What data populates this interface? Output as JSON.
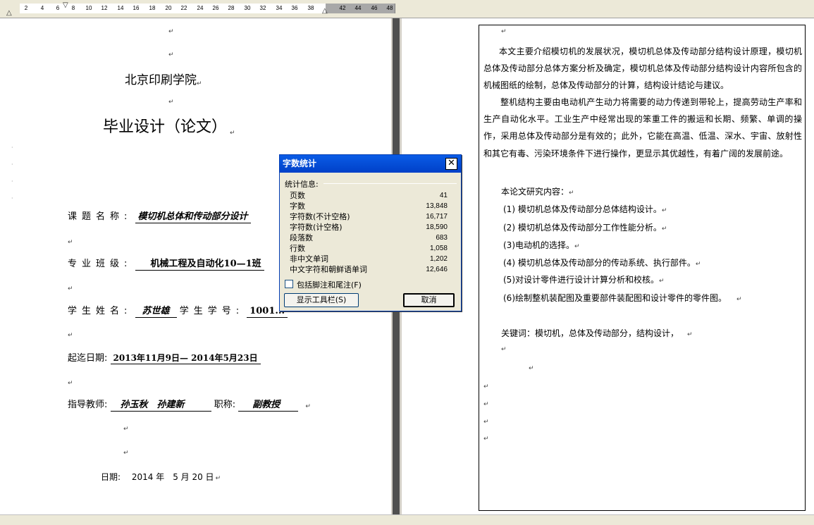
{
  "ruler": {
    "numbers": [
      "2",
      "4",
      "6",
      "8",
      "10",
      "12",
      "14",
      "16",
      "18",
      "20",
      "22",
      "24",
      "26",
      "28",
      "30",
      "32",
      "34",
      "36",
      "38",
      "42",
      "44",
      "46",
      "48"
    ]
  },
  "left_page": {
    "school_name": "北京印刷学院",
    "thesis_title": "毕业设计（论文）",
    "fields": {
      "topic_label": "课题名称:",
      "topic_value": "模切机总体和传动部分设计",
      "major_label": "专业班级:",
      "major_value": "机械工程及自动化10—1班",
      "student_label": "学生姓名:",
      "student_value": "苏世雄",
      "student_id_label": "学生学号:",
      "student_id_value": "1001...",
      "dates_label": "起迄日期:",
      "dates_value": "2013年11月9日— 2014年5月23日",
      "advisor_label": "指导教师:",
      "advisor_value": "孙玉秋　孙建新",
      "title_label": "职称:",
      "title_value": "副教授"
    },
    "date_line": "日期:　 2014 年　5 月 20 日"
  },
  "right_page": {
    "para1": "本文主要介绍模切机的发展状况，模切机总体及传动部分结构设计原理，模切机总体及传动部分总体方案分析及确定，模切机总体及传动部分结构设计内容所包含的机械图纸的绘制，总体及传动部分的计算，结构设计结论与建议。",
    "para2": "整机结构主要由电动机产生动力将需要的动力传递到带轮上，提高劳动生产率和生产自动化水平。工业生产中经常出现的笨重工件的搬运和长期、频繁、单调的操作，采用总体及传动部分是有效的；此外，它能在高温、低温、深水、宇宙、放射性和其它有毒、污染环境条件下进行操作，更显示其优越性，有着广阔的发展前途。",
    "research_heading": "本论文研究内容：",
    "items": [
      "(1)  模切机总体及传动部分总体结构设计。",
      "(2)  模切机总体及传动部分工作性能分析。",
      "(3)电动机的选择。",
      "(4)  模切机总体及传动部分的传动系统、执行部件。",
      "(5)对设计零件进行设计计算分析和校核。",
      "(6)绘制整机装配图及重要部件装配图和设计零件的零件图。"
    ],
    "keywords": "关键词：模切机，总体及传动部分，结构设计，"
  },
  "dialog": {
    "title": "字数统计",
    "close_glyph": "✕",
    "stats_header": "统计信息:",
    "stats": [
      {
        "label": "页数",
        "value": "41"
      },
      {
        "label": "字数",
        "value": "13,848"
      },
      {
        "label": "字符数(不计空格)",
        "value": "16,717"
      },
      {
        "label": "字符数(计空格)",
        "value": "18,590"
      },
      {
        "label": "段落数",
        "value": "683"
      },
      {
        "label": "行数",
        "value": "1,058"
      },
      {
        "label": "非中文单词",
        "value": "1,202"
      },
      {
        "label": "中文字符和朝鲜语单词",
        "value": "12,646"
      }
    ],
    "checkbox_label": "包括脚注和尾注(F)",
    "checkbox_checked": false,
    "toolbar_button": "显示工具栏(S)",
    "cancel_button": "取消"
  },
  "colors": {
    "title_bar": "#0a5ce6",
    "dialog_bg": "#ece9d8",
    "divider": "#505050"
  },
  "icons": {
    "paragraph_mark": "return-arrow-icon",
    "close": "close-icon"
  }
}
